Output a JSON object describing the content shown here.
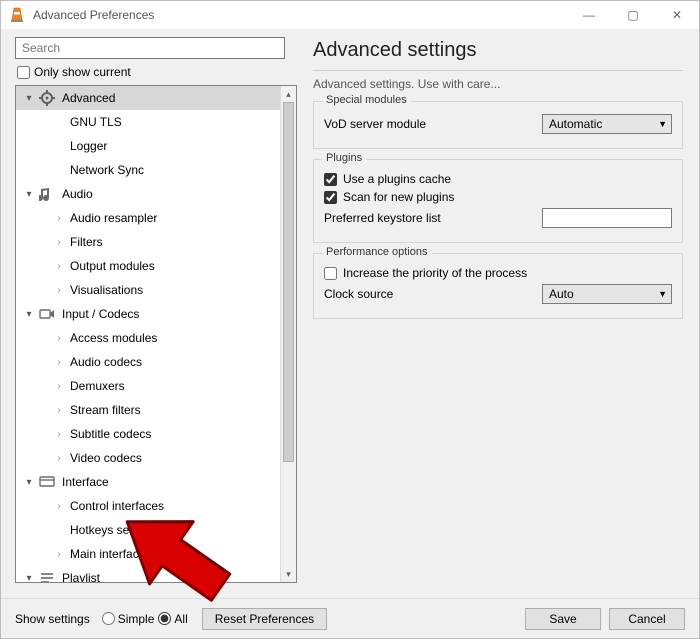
{
  "window": {
    "title": "Advanced Preferences"
  },
  "win_controls": {
    "min": "—",
    "max": "▢",
    "close": "✕"
  },
  "search": {
    "placeholder": "Search"
  },
  "only_show_label": "Only show current",
  "tree": {
    "advanced": {
      "label": "Advanced",
      "children": [
        "GNU TLS",
        "Logger",
        "Network Sync"
      ]
    },
    "audio": {
      "label": "Audio",
      "children": [
        "Audio resampler",
        "Filters",
        "Output modules",
        "Visualisations"
      ]
    },
    "input": {
      "label": "Input / Codecs",
      "children": [
        "Access modules",
        "Audio codecs",
        "Demuxers",
        "Stream filters",
        "Subtitle codecs",
        "Video codecs"
      ]
    },
    "interface": {
      "label": "Interface",
      "children": [
        "Control interfaces",
        "Hotkeys settings",
        "Main interfaces"
      ]
    },
    "playlist": {
      "label": "Playlist"
    }
  },
  "right": {
    "title": "Advanced settings",
    "subtitle": "Advanced settings. Use with care...",
    "special": {
      "legend": "Special modules",
      "vod_label": "VoD server module",
      "vod_value": "Automatic"
    },
    "plugins": {
      "legend": "Plugins",
      "use_cache": "Use a plugins cache",
      "scan": "Scan for new plugins",
      "keystore": "Preferred keystore list"
    },
    "perf": {
      "legend": "Performance options",
      "priority": "Increase the priority of the process",
      "clock_label": "Clock source",
      "clock_value": "Auto"
    }
  },
  "footer": {
    "show_settings": "Show settings",
    "simple": "Simple",
    "all": "All",
    "reset": "Reset Preferences",
    "save": "Save",
    "cancel": "Cancel"
  }
}
